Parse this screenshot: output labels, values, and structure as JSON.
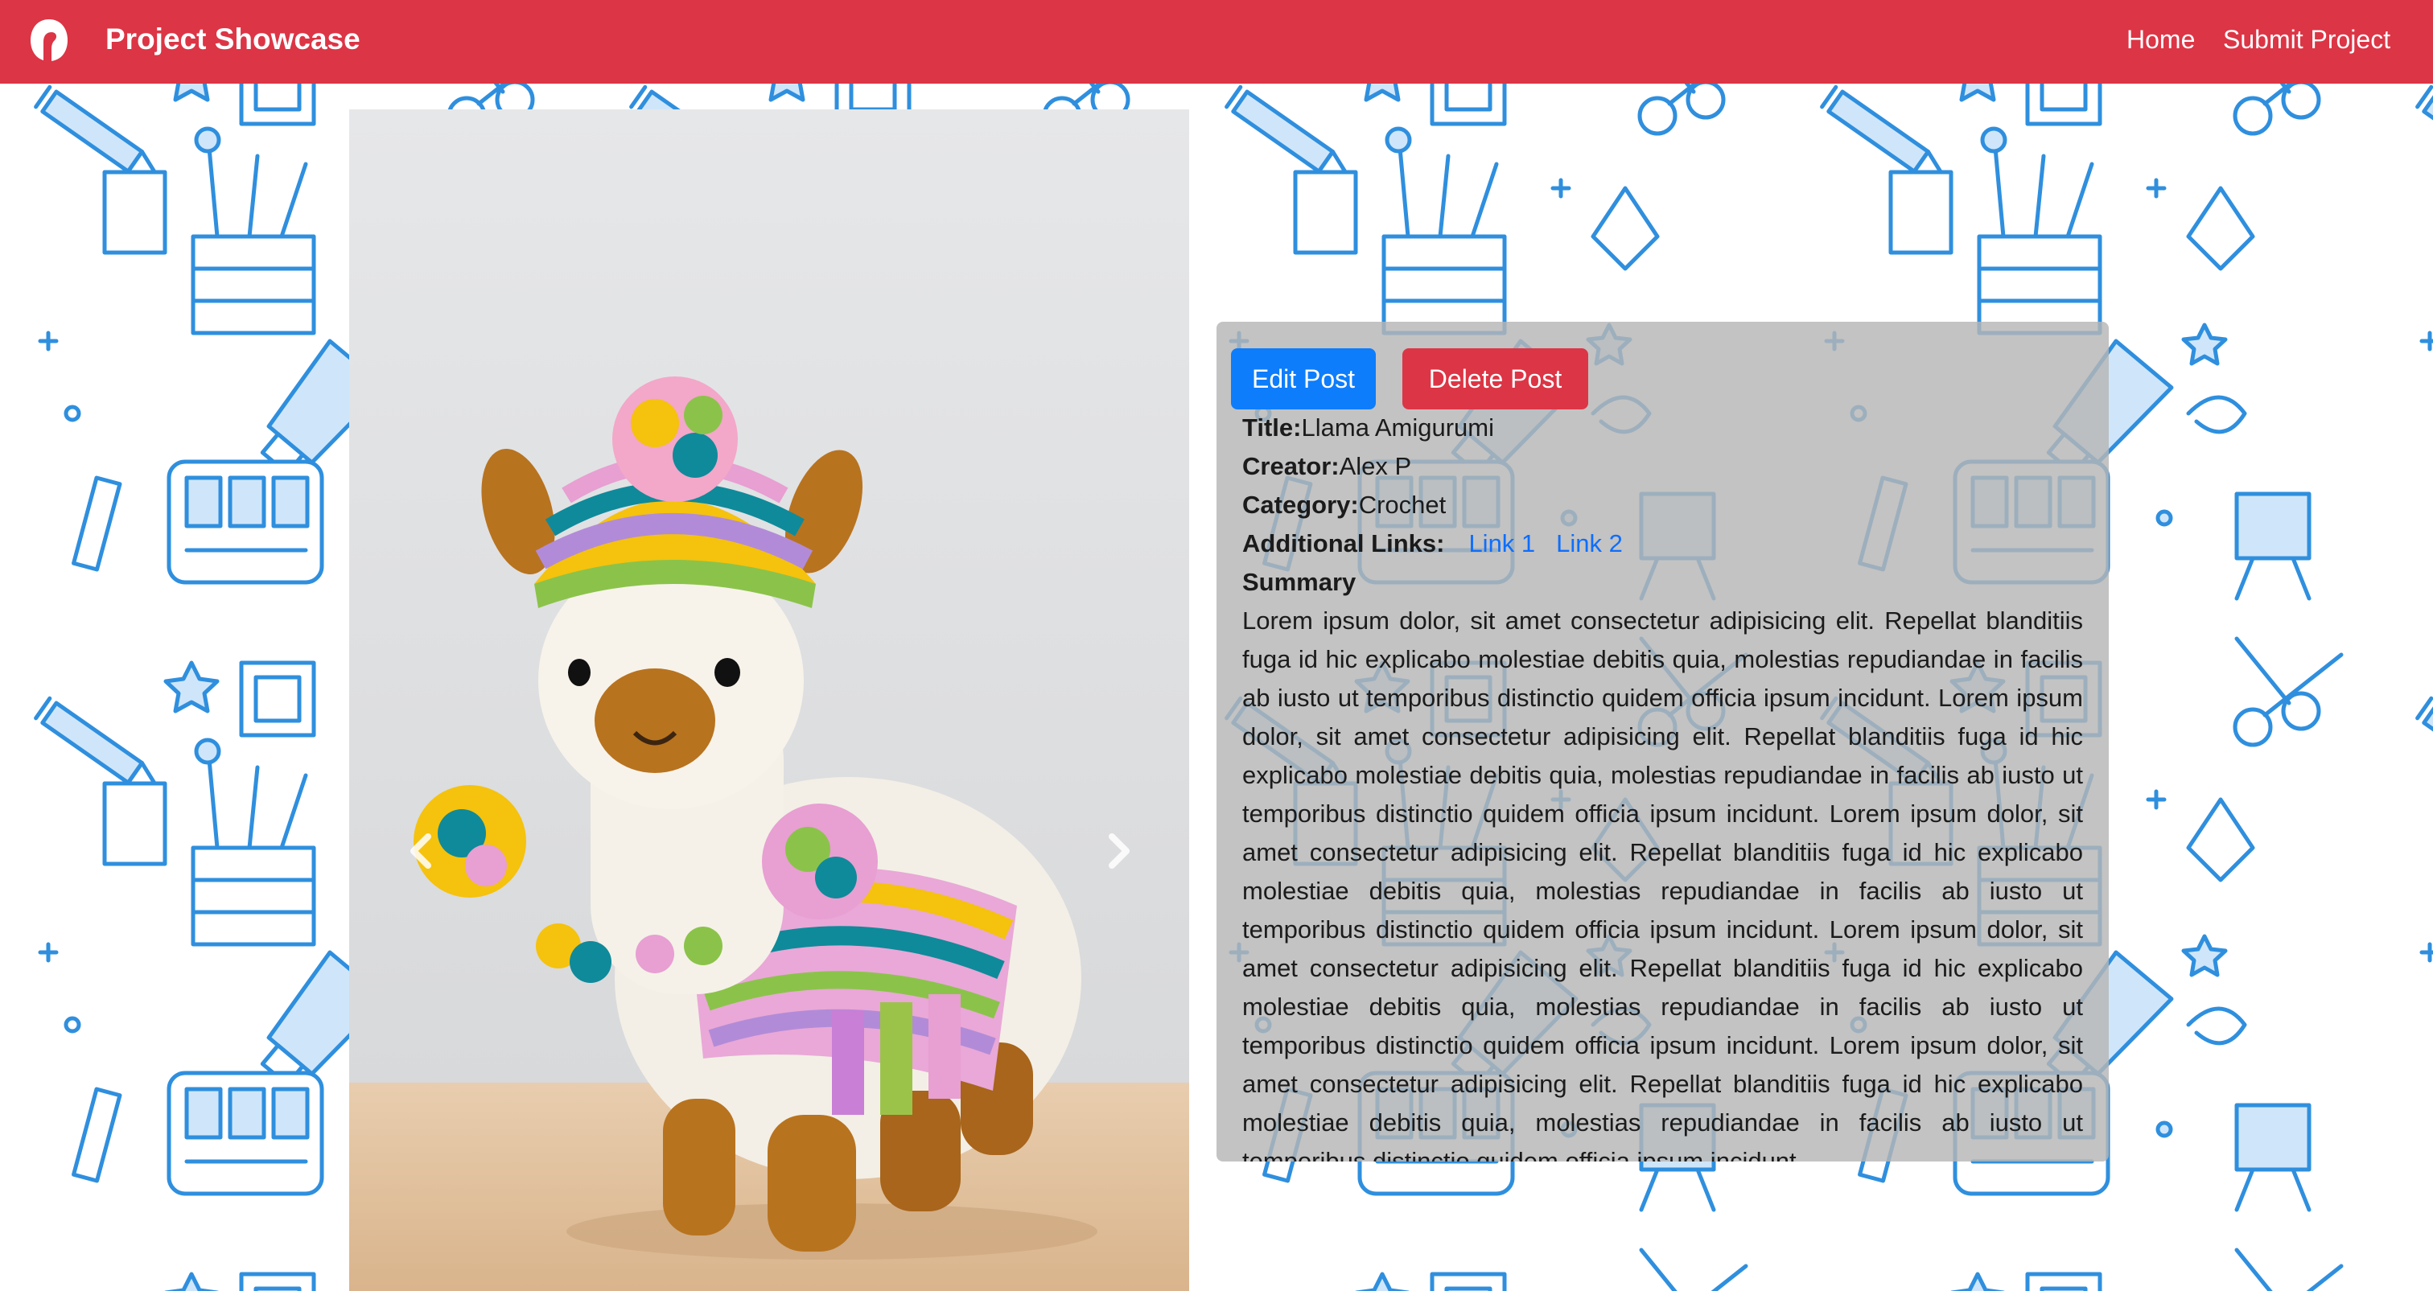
{
  "navbar": {
    "brand": "Project Showcase",
    "links": [
      "Home",
      "Submit Project"
    ],
    "color": "#dc3545"
  },
  "carousel": {
    "image_alt": "Crocheted llama amigurumi wearing a striped hat with pom-poms",
    "prev_icon": "chevron-left-icon",
    "next_icon": "chevron-right-icon"
  },
  "post": {
    "buttons": {
      "edit": "Edit Post",
      "delete": "Delete Post"
    },
    "title_label": "Title:",
    "title": "Llama Amigurumi",
    "creator_label": "Creator:",
    "creator": "Alex P",
    "category_label": "Category:",
    "category": "Crochet",
    "links_label": "Additional Links:",
    "links": [
      "Link 1",
      "Link 2"
    ],
    "summary_label": "Summary",
    "summary": "Lorem ipsum dolor, sit amet consectetur adipisicing elit. Repellat blanditiis fuga id hic explicabo molestiae debitis quia, molestias repudiandae in facilis ab iusto ut temporibus distinctio quidem officia ipsum incidunt. Lorem ipsum dolor, sit amet consectetur adipisicing elit. Repellat blanditiis fuga id hic explicabo molestiae debitis quia, molestias repudiandae in facilis ab iusto ut temporibus distinctio quidem officia ipsum incidunt. Lorem ipsum dolor, sit amet consectetur adipisicing elit. Repellat blanditiis fuga id hic explicabo molestiae debitis quia, molestias repudiandae in facilis ab iusto ut temporibus distinctio quidem officia ipsum incidunt. Lorem ipsum dolor, sit amet consectetur adipisicing elit. Repellat blanditiis fuga id hic explicabo molestiae debitis quia, molestias repudiandae in facilis ab iusto ut temporibus distinctio quidem officia ipsum incidunt. Lorem ipsum dolor, sit amet consectetur adipisicing elit. Repellat blanditiis fuga id hic explicabo molestiae debitis quia, molestias repudiandae in facilis ab iusto ut temporibus distinctio quidem officia ipsum incidunt."
  },
  "colors": {
    "edit_button": "#0d7dfb",
    "delete_button": "#dc3545",
    "link": "#0d6efd",
    "pattern": "#2f8fde"
  }
}
